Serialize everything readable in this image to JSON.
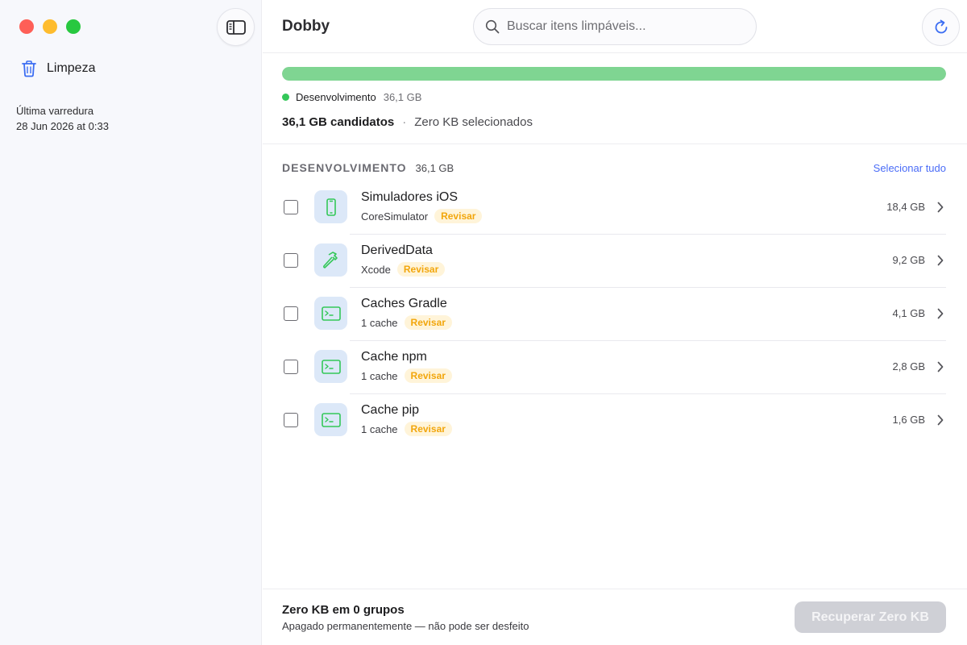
{
  "sidebar": {
    "nav": [
      {
        "label": "Limpeza",
        "icon": "trash-icon"
      }
    ],
    "last_scan_label": "Última varredura",
    "last_scan_value": "28 Jun 2026 at 0:33"
  },
  "header": {
    "title": "Dobby",
    "search_placeholder": "Buscar itens limpáveis..."
  },
  "summary": {
    "progress_fraction": 1.0,
    "legend_label": "Desenvolvimento",
    "legend_size": "36,1 GB",
    "candidates": "36,1 GB candidatos",
    "separator": "·",
    "selected": "Zero KB selecionados"
  },
  "section": {
    "title": "DESENVOLVIMENTO",
    "size": "36,1 GB",
    "select_all": "Selecionar tudo"
  },
  "items": [
    {
      "name": "Simuladores iOS",
      "sub": "CoreSimulator",
      "badge": "Revisar",
      "size": "18,4 GB",
      "icon": "iphone-icon"
    },
    {
      "name": "DerivedData",
      "sub": "Xcode",
      "badge": "Revisar",
      "size": "9,2 GB",
      "icon": "hammer-icon"
    },
    {
      "name": "Caches Gradle",
      "sub": "1 cache",
      "badge": "Revisar",
      "size": "4,1 GB",
      "icon": "terminal-icon"
    },
    {
      "name": "Cache npm",
      "sub": "1 cache",
      "badge": "Revisar",
      "size": "2,8 GB",
      "icon": "terminal-icon"
    },
    {
      "name": "Cache pip",
      "sub": "1 cache",
      "badge": "Revisar",
      "size": "1,6 GB",
      "icon": "terminal-icon"
    }
  ],
  "footer": {
    "title": "Zero KB em 0 grupos",
    "subtitle": "Apagado permanentemente — não pode ser desfeito",
    "button": "Recuperar Zero KB"
  },
  "colors": {
    "accent": "#4a6cf7",
    "progress": "#7fd592",
    "badge_text": "#f2a60c",
    "badge_bg": "#fff4d9",
    "icon_green": "#34c759"
  }
}
